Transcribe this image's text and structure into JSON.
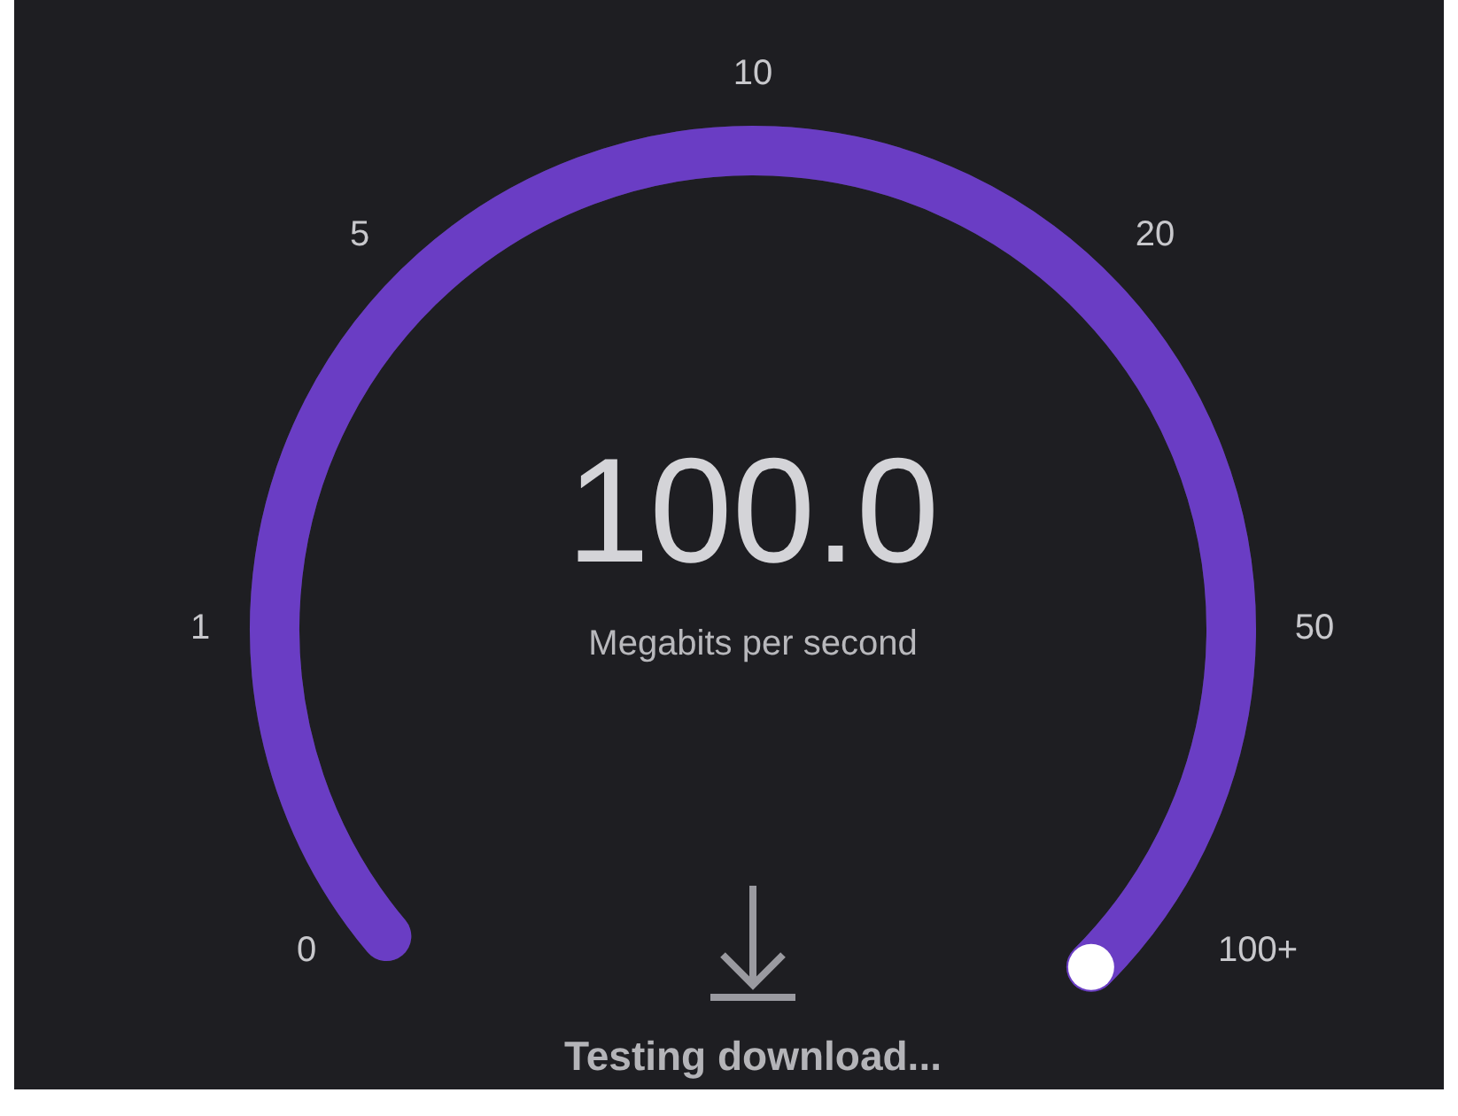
{
  "gauge": {
    "reading": "100.0",
    "unit": "Megabits per second",
    "level": 1,
    "scale": [
      "0",
      "1",
      "5",
      "10",
      "20",
      "50",
      "100+"
    ]
  },
  "status": "Testing download..."
}
